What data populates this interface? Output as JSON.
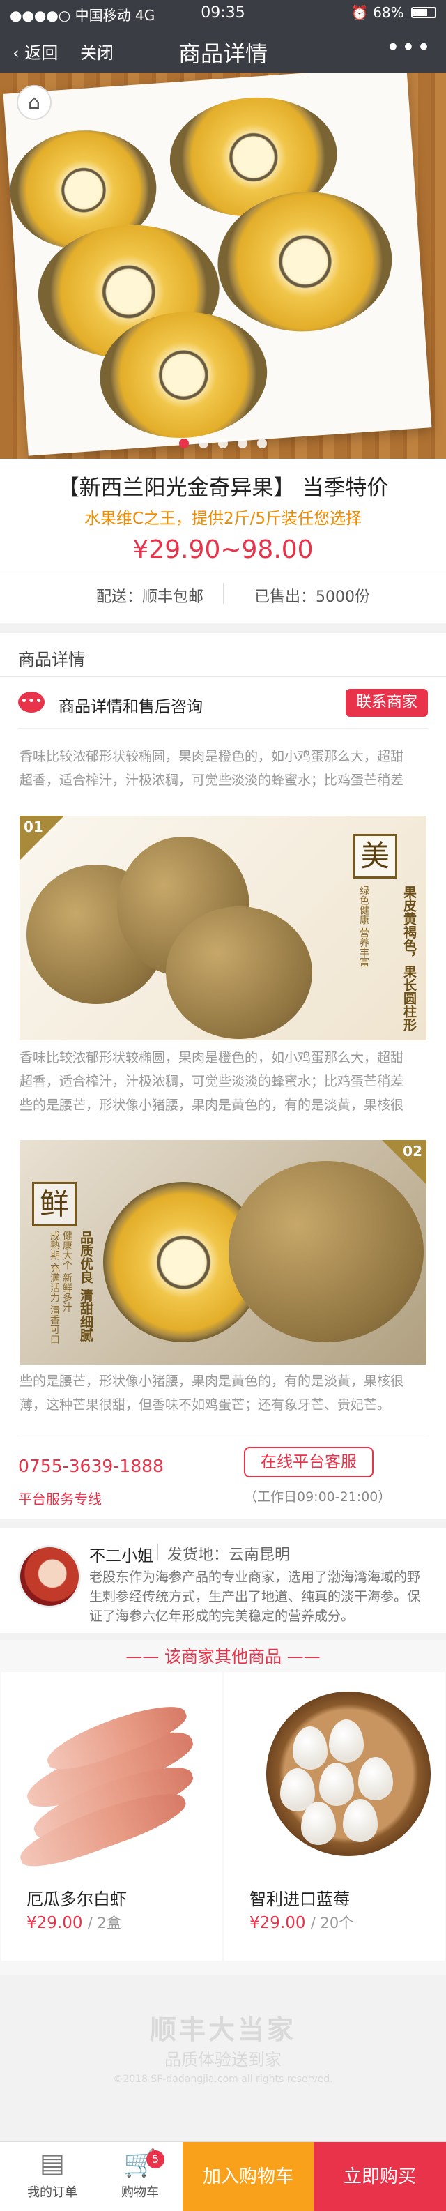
{
  "status_bar": {
    "carrier": "中国移动",
    "network": "4G",
    "time": "09:35",
    "battery": "68%",
    "battery_level": 0.68
  },
  "nav": {
    "back": "返回",
    "close": "关闭",
    "title": "商品详情",
    "more": "•••"
  },
  "hero": {
    "icon": "home-icon",
    "carousel_count": 5,
    "carousel_active": 0
  },
  "product": {
    "name": "【新西兰阳光金奇异果】 当季特价",
    "subtitle": "水果维C之王，提供2斤/5斤装任您选择",
    "price": "¥29.90~98.00",
    "shipping": "配送：顺丰包邮",
    "sold": "已售出：5000份"
  },
  "details": {
    "header": "商品详情",
    "consult_label": "商品详情和售后咨询",
    "contact_button": "联系商家",
    "paragraphs": [
      "香味比较浓郁形状较椭圆，果肉是橙色的，如小鸡蛋那么大，超甜",
      "超香，适合榨汁，汁极浓稠，可觉些淡淡的蜂蜜水；比鸡蛋芒稍差",
      "香味比较浓郁形状较椭圆，果肉是橙色的，如小鸡蛋那么大，超甜",
      "超香，适合榨汁，汁极浓稠，可觉些淡淡的蜂蜜水；比鸡蛋芒稍差",
      "些的是腰芒，形状像小猪腰，果肉是黄色的，有的是淡黄，果核很",
      "些的是腰芒，形状像小猪腰，果肉是黄色的，有的是淡黄，果核很",
      "薄，这种芒果很甜，但香味不如鸡蛋芒；还有象牙芒、贵妃芒。"
    ],
    "photo1": {
      "number": "01",
      "badge": "美",
      "line1": "果皮黄褐色，果长圆柱形",
      "line2": "绿色健康 营养丰富"
    },
    "photo2": {
      "number": "02",
      "badge": "鲜",
      "line1": "品质优良 清甜细腻",
      "line2": "健康大个 新鲜多汁",
      "line3": "成熟期 充满活力 清香可口"
    }
  },
  "service": {
    "phone": "0755-3639-1888",
    "phone_label": "平台服务专线",
    "online_button": "在线平台客服",
    "hours": "（工作日09:00-21:00）"
  },
  "merchant": {
    "name": "不二小姐",
    "origin": "发货地：云南昆明",
    "description": "老股东作为海参产品的专业商家，选用了渤海湾海域的野生刺参经传统方式，生产出了地道、纯真的淡干海参。保证了海参六亿年形成的完美稳定的营养成分。"
  },
  "others": {
    "title": "—— 该商家其他商品 ——",
    "items": [
      {
        "name": "厄瓜多尔白虾",
        "price": "¥29.00",
        "unit": "/ 2盒"
      },
      {
        "name": "智利进口蓝莓",
        "price": "¥29.00",
        "unit": "/ 20个"
      }
    ]
  },
  "brand": {
    "name": "顺丰大当家",
    "slogan": "品质体验送到家",
    "copyright": "©2018 SF-dadangjia.com all rights reserved."
  },
  "bottom": {
    "orders": "我的订单",
    "cart": "购物车",
    "cart_count": "5",
    "add_to_cart": "加入购物车",
    "buy_now": "立即购买"
  }
}
